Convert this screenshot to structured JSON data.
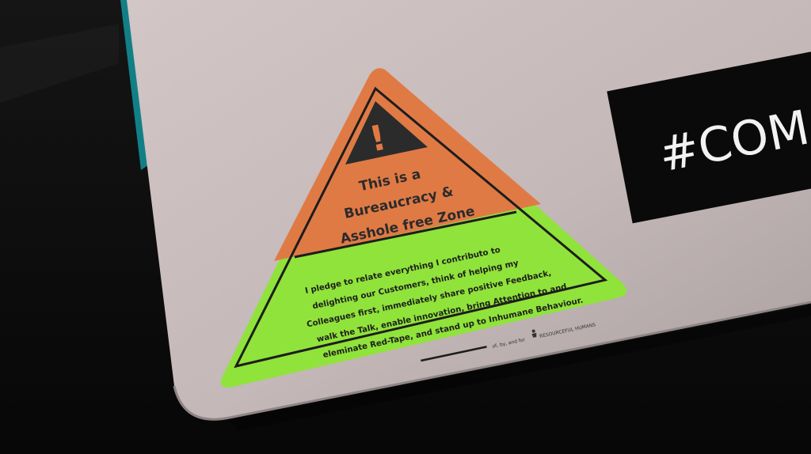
{
  "sticker": {
    "warning_symbol": "!",
    "heading_lines": [
      "This is a",
      "Bureaucracy &",
      "Asshole free Zone"
    ],
    "pledge_lines": [
      "I pledge to relate everything I contributo to",
      "delighting our Customers, think of helping my",
      "Colleagues first, immediately share positive Feedback,",
      "walk the Talk, enable innovation, bring Attention to and",
      "eleminate Red-Tape, and stand up to Inhumane Behaviour."
    ],
    "credit_prefix": "of, by, and for",
    "brand_name": "RESOURCEFUL HUMANS",
    "brand_icon": "person-logo-icon",
    "colors": {
      "orange": "#e07a45",
      "green": "#90e33a",
      "ink": "#1d1d1d"
    }
  },
  "second_sticker": {
    "text": "#COM"
  },
  "laptop": {
    "color": "#c7bbbb"
  }
}
